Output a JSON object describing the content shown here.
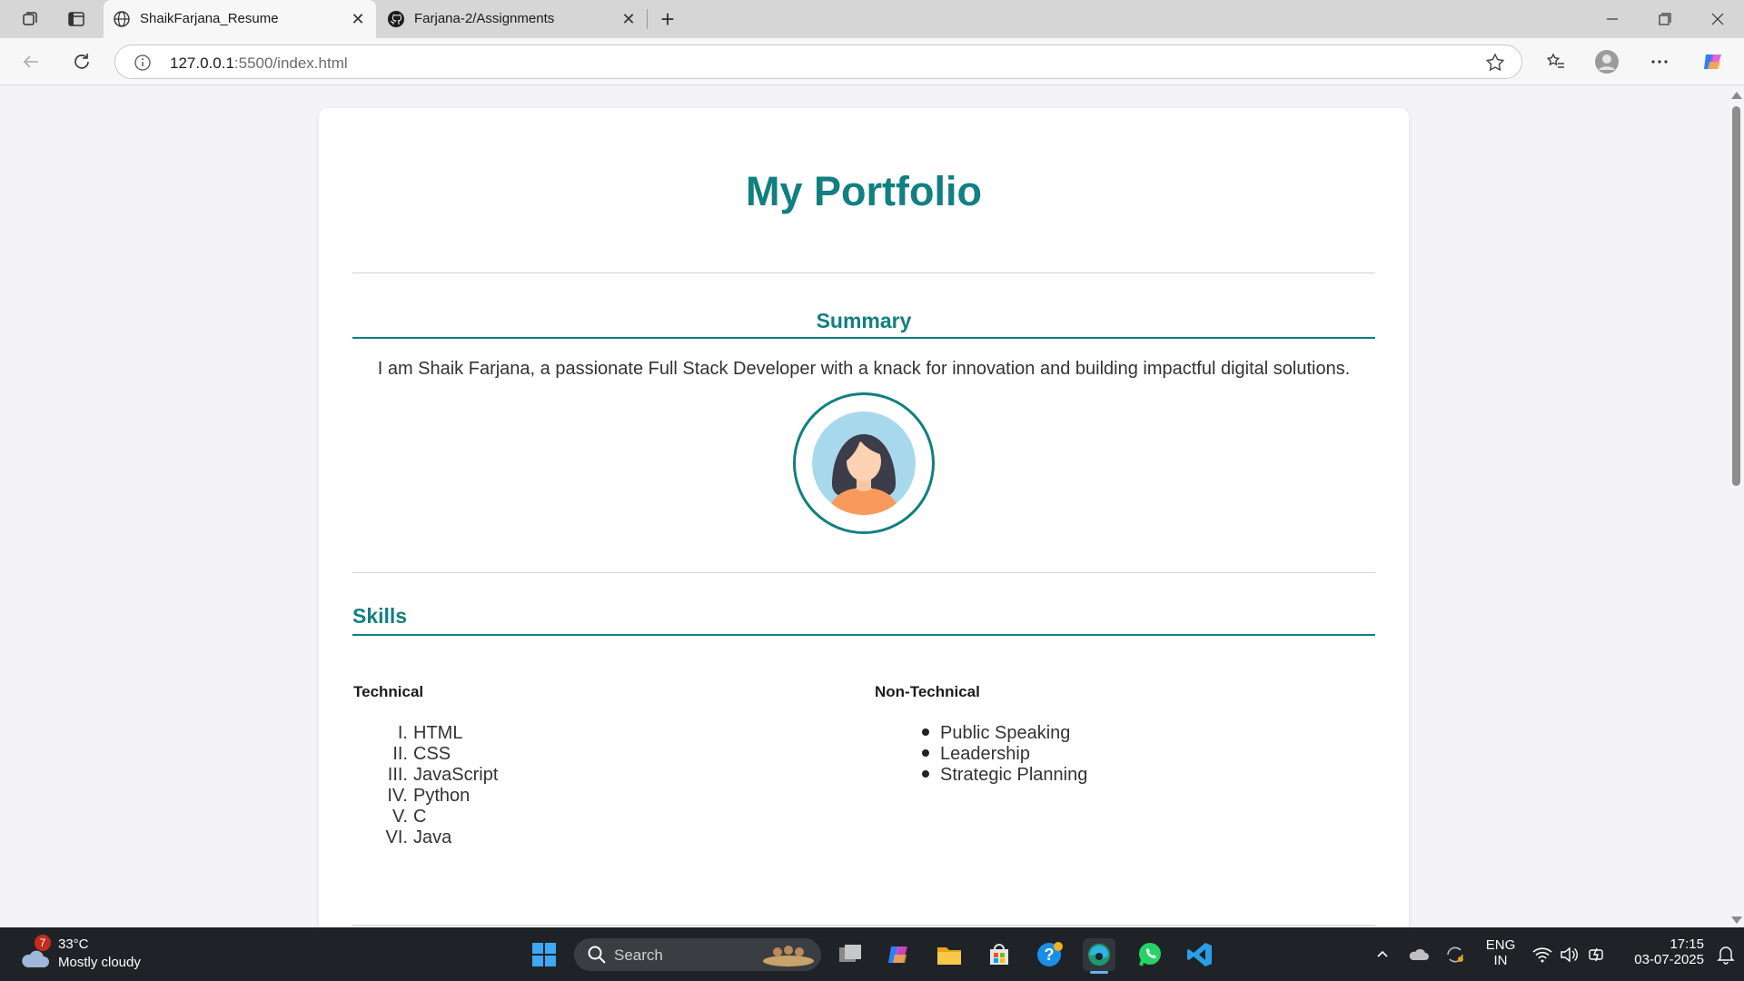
{
  "browser": {
    "tabs": [
      {
        "title": "ShaikFarjana_Resume",
        "active": true
      },
      {
        "title": "Farjana-2/Assignments",
        "active": false
      }
    ],
    "address": {
      "host": "127.0.0.1",
      "rest": ":5500/index.html"
    }
  },
  "page": {
    "title": "My Portfolio",
    "summary": {
      "heading": "Summary",
      "text": "I am Shaik Farjana, a passionate Full Stack Developer with a knack for innovation and building impactful digital solutions."
    },
    "skills": {
      "heading": "Skills",
      "technical": {
        "heading": "Technical",
        "items": [
          {
            "num": "I.",
            "label": "HTML"
          },
          {
            "num": "II.",
            "label": "CSS"
          },
          {
            "num": "III.",
            "label": "JavaScript"
          },
          {
            "num": "IV.",
            "label": "Python"
          },
          {
            "num": "V.",
            "label": "C"
          },
          {
            "num": "VI.",
            "label": "Java"
          }
        ]
      },
      "non_technical": {
        "heading": "Non-Technical",
        "items": [
          "Public Speaking",
          "Leadership",
          "Strategic Planning"
        ]
      }
    }
  },
  "taskbar": {
    "weather": {
      "temp": "33°C",
      "condition": "Mostly cloudy",
      "badge": "7"
    },
    "search_placeholder": "Search",
    "lang": "ENG",
    "region": "IN",
    "time": "17:15",
    "date": "03-07-2025"
  },
  "colors": {
    "accent": "#127f80",
    "page_bg": "#f4f4f8",
    "taskbar": "#1f2328"
  }
}
